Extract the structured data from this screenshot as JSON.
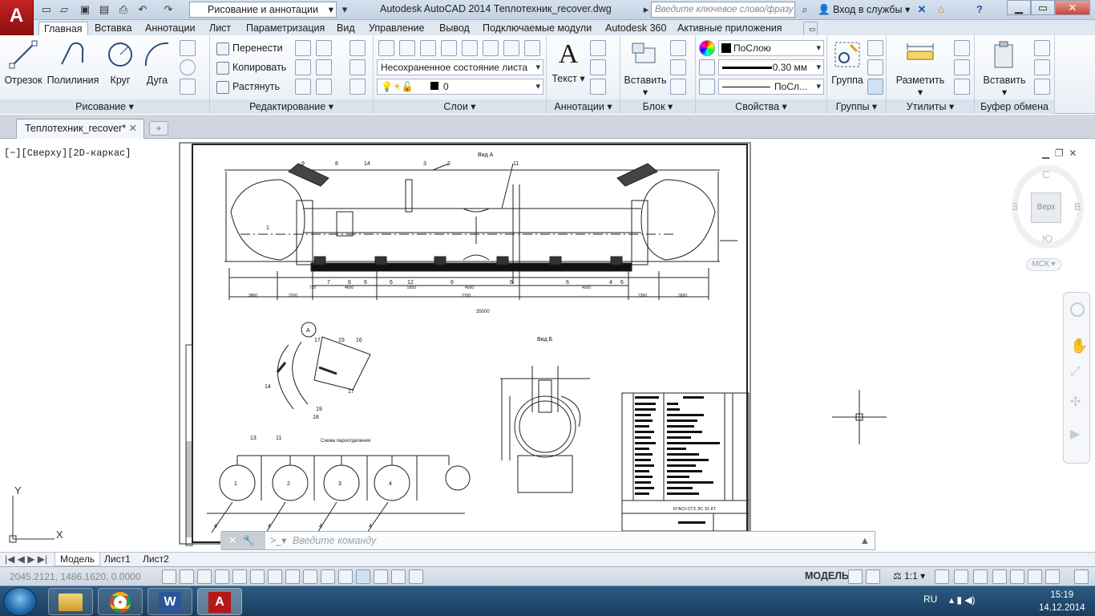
{
  "app": {
    "logo": "A",
    "workspace": "Рисование и аннотации",
    "title": "Autodesk AutoCAD 2014   Теплотехник_recover.dwg",
    "search_placeholder": "Введите ключевое слово/фразу",
    "signin": "Вход в службы",
    "help": "?"
  },
  "ribbon_tabs": [
    "Главная",
    "Вставка",
    "Аннотации",
    "Лист",
    "Параметризация",
    "Вид",
    "Управление",
    "Вывод",
    "Подключаемые модули",
    "Autodesk 360",
    "Активные приложения"
  ],
  "panels": {
    "draw": {
      "label": "Рисование",
      "line": "Отрезок",
      "polyline": "Полилиния",
      "circle": "Круг",
      "arc": "Дуга"
    },
    "modify": {
      "label": "Редактирование",
      "move": "Перенести",
      "copy": "Копировать",
      "stretch": "Растянуть"
    },
    "layers": {
      "label": "Слои",
      "state": "Несохраненное состояние листа",
      "current": "0"
    },
    "annotation": {
      "label": "Аннотации",
      "text": "Текст"
    },
    "block": {
      "label": "Блок",
      "insert": "Вставить"
    },
    "properties": {
      "label": "Свойства",
      "color": "ПоСлою",
      "lineweight": "0.30 мм",
      "linetype": "ПоСл..."
    },
    "groups": {
      "label": "Группы",
      "group": "Группа"
    },
    "utilities": {
      "label": "Утилиты",
      "measure": "Разметить"
    },
    "clipboard": {
      "label": "Буфер обмена",
      "paste": "Вставить"
    }
  },
  "document": {
    "tab": "Теплотехник_recover*"
  },
  "viewport": {
    "label": "[−][Сверху][2D-каркас]"
  },
  "viewcube": {
    "n": "С",
    "s": "Ю",
    "w": "З",
    "e": "В",
    "face": "Верх",
    "ucs": "МСК"
  },
  "drawing": {
    "view_a": "Вид А",
    "view_b": "Вид Б",
    "detail": "А",
    "scheme": "Схема пароотделения",
    "dims_bottom": [
      "3800",
      "2200",
      "720",
      "4600",
      "5850",
      "2700",
      "4500",
      "4500",
      "2300",
      "3500"
    ],
    "total": "35000",
    "callouts": [
      "1",
      "2",
      "3",
      "4",
      "5",
      "6",
      "7",
      "8",
      "9",
      "10",
      "11",
      "12",
      "13",
      "14",
      "15",
      "16",
      "17",
      "18",
      "19"
    ],
    "tanks": [
      "1",
      "2",
      "3",
      "4"
    ],
    "stamp": "КГАСУ.СТЗ.ЭС 31 КТ"
  },
  "command": {
    "placeholder": "Введите команду"
  },
  "layout_tabs": [
    "Модель",
    "Лист1",
    "Лист2"
  ],
  "status": {
    "coords": "2045.2121, 1486.1620, 0.0000",
    "space": "МОДЕЛЬ",
    "scale": "1:1"
  },
  "taskbar": {
    "lang": "RU",
    "time": "15:19",
    "date": "14.12.2014"
  },
  "colors": {
    "accent": "#b51818",
    "ribbon_bg": "#e8eef5",
    "taskbar": "#1f4a70"
  }
}
